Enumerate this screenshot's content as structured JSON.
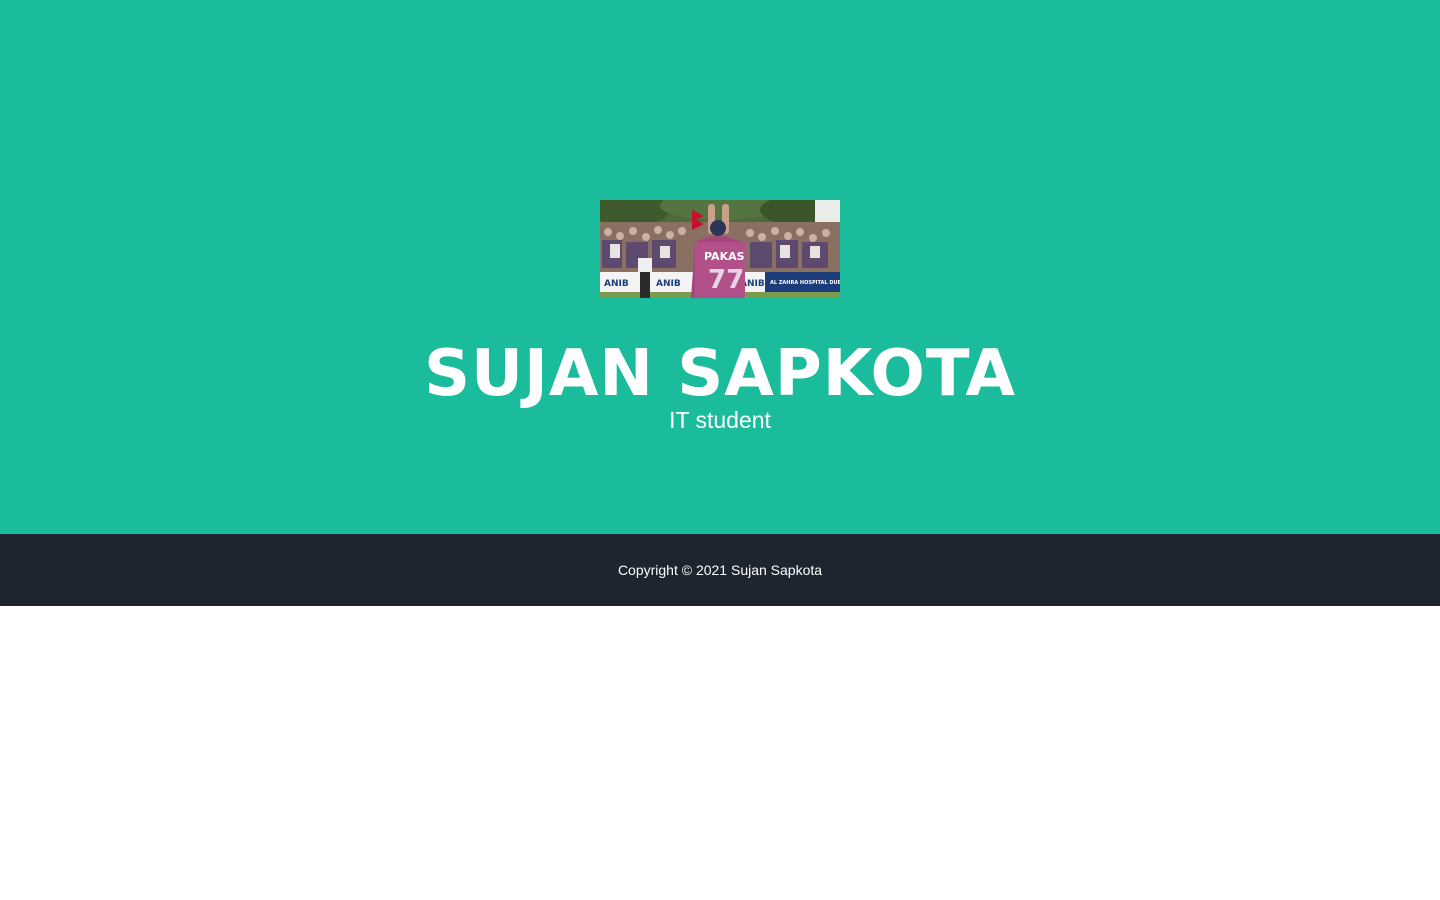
{
  "masthead": {
    "name": "SUJAN SAPKOTA",
    "subtitle": "IT student",
    "background_color": "#1abc9c",
    "photo": {
      "icon": "profile-photo-cricket-player",
      "jersey_text": "PAKAS",
      "jersey_number": "77",
      "banner_texts": [
        "ANIB",
        "ANIB",
        "ANIB",
        "AL ZAHRA HOSPITAL DUBAI"
      ]
    }
  },
  "footer": {
    "copyright": "Copyright © 2021 Sujan Sapkota",
    "background_color": "#1c2530"
  }
}
